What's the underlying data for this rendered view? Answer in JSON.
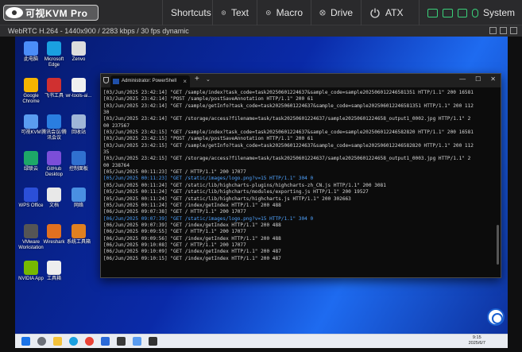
{
  "app": {
    "logo_text": "可视KVM Pro",
    "stream_info": "WebRTC H.264 - 1440x900 / 2283 kbps / 30 fps dynamic"
  },
  "menu": {
    "shortcuts": "Shortcuts",
    "text": "Text",
    "macro": "Macro",
    "drive": "Drive",
    "atx": "ATX",
    "system": "System"
  },
  "icons": {
    "text": "gear-icon",
    "macro": "gear-icon",
    "drive": "disc-icon",
    "atx": "power-icon"
  },
  "colors": {
    "accent_green": "#3ad17a",
    "link_blue": "#4fa3ff"
  },
  "desktop_icons": [
    {
      "label": "此电脑",
      "color": "#4b8df8"
    },
    {
      "label": "Microsoft Edge",
      "color": "#1aa0e0"
    },
    {
      "label": "Zenvo",
      "color": "#dddddd"
    },
    {
      "label": "Google Chrome",
      "color": "#f4b400"
    },
    {
      "label": "飞书工具",
      "color": "#d03030"
    },
    {
      "label": "wr-tools-ai...",
      "color": "#f0f0f0"
    },
    {
      "label": "可视KVM",
      "color": "#5a9cf0"
    },
    {
      "label": "腾讯会议/腾讯会议",
      "color": "#2a7ee0"
    },
    {
      "label": "回收站",
      "color": "#9fb6d8"
    },
    {
      "label": "绿联云",
      "color": "#1da868"
    },
    {
      "label": "GitHub Desktop",
      "color": "#7b4ed8"
    },
    {
      "label": "控制面板",
      "color": "#3070d0"
    },
    {
      "label": "WPS Office",
      "color": "#2b4fd8"
    },
    {
      "label": "文档",
      "color": "#e8e8e8"
    },
    {
      "label": "网络",
      "color": "#4a90e2"
    },
    {
      "label": "VMware Workstation",
      "color": "#555555"
    },
    {
      "label": "Wireshark",
      "color": "#e07020"
    },
    {
      "label": "系统工具箱",
      "color": "#e08020"
    },
    {
      "label": "NVIDIA App",
      "color": "#76b900"
    },
    {
      "label": "工具箱",
      "color": "#eeeeee"
    }
  ],
  "terminal": {
    "tab_title": "Administrator: PowerShell",
    "lines": [
      {
        "text": "[03/Jun/2025 23:42:14] \"GET /sample/index?task_code=task20250601224637&sample_code=sample202506012246581351 HTTP/1.1\" 200 16581",
        "blue": false
      },
      {
        "text": "[03/Jun/2025 23:42:14] \"POST /sample/postSaveAnnotation HTTP/1.1\" 200 61",
        "blue": false
      },
      {
        "text": "[03/Jun/2025 23:42:14] \"GET /sample/getInfo?task_code=task20250601224637&sample_code=sample202506012246581351 HTTP/1.1\" 200 112",
        "blue": false
      },
      {
        "text": "30",
        "blue": false
      },
      {
        "text": "[03/Jun/2025 23:42:14] \"GET /storage/access?filename=task/task20250601224637/sample20250601224658_output1_0002.jpg HTTP/1.1\" 2",
        "blue": false
      },
      {
        "text": "00 237567",
        "blue": false
      },
      {
        "text": "[03/Jun/2025 23:42:15] \"GET /sample/index?task_code=task20250601224637&sample_code=sample202506012246582820 HTTP/1.1\" 200 16581",
        "blue": false
      },
      {
        "text": "[03/Jun/2025 23:42:15] \"POST /sample/postSaveAnnotation HTTP/1.1\" 200 61",
        "blue": false
      },
      {
        "text": "[03/Jun/2025 23:42:15] \"GET /sample/getInfo?task_code=task20250601224637&sample_code=sample202506012246582820 HTTP/1.1\" 200 112",
        "blue": false
      },
      {
        "text": "35",
        "blue": false
      },
      {
        "text": "[03/Jun/2025 23:42:15] \"GET /storage/access?filename=task/task20250601224637/sample20250601224658_output1_0003.jpg HTTP/1.1\" 2",
        "blue": false
      },
      {
        "text": "00 238764",
        "blue": false
      },
      {
        "text": "[05/Jun/2025 00:11:23] \"GET / HTTP/1.1\" 200 17077",
        "blue": false
      },
      {
        "text": "[05/Jun/2025 00:11:23] \"GET /static/images/logo.png?v=15 HTTP/1.1\" 304 0",
        "blue": true
      },
      {
        "text": "[05/Jun/2025 00:11:24] \"GET /static/lib/highcharts-plugins/highcharts-zh_CN.js HTTP/1.1\" 200 3081",
        "blue": false
      },
      {
        "text": "[05/Jun/2025 00:11:24] \"GET /static/lib/highcharts/modules/exporting.js HTTP/1.1\" 200 19527",
        "blue": false
      },
      {
        "text": "[05/Jun/2025 00:11:24] \"GET /static/lib/highcharts/highcharts.js HTTP/1.1\" 200 302663",
        "blue": false
      },
      {
        "text": "[05/Jun/2025 00:11:24] \"GET /index/getIndex HTTP/1.1\" 200 488",
        "blue": false
      },
      {
        "text": "[06/Jun/2025 09:07:38] \"GET / HTTP/1.1\" 200 17077",
        "blue": false
      },
      {
        "text": "[06/Jun/2025 09:07:39] \"GET /static/images/logo.png?v=15 HTTP/1.1\" 304 0",
        "blue": true
      },
      {
        "text": "[06/Jun/2025 09:07:39] \"GET /index/getIndex HTTP/1.1\" 200 488",
        "blue": false
      },
      {
        "text": "[06/Jun/2025 09:09:55] \"GET / HTTP/1.1\" 200 17077",
        "blue": false
      },
      {
        "text": "[06/Jun/2025 09:09:56] \"GET /index/getIndex HTTP/1.1\" 200 488",
        "blue": false
      },
      {
        "text": "[06/Jun/2025 09:10:08] \"GET / HTTP/1.1\" 200 17077",
        "blue": false
      },
      {
        "text": "[06/Jun/2025 09:10:09] \"GET /index/getIndex HTTP/1.1\" 200 487",
        "blue": false
      },
      {
        "text": "[06/Jun/2025 09:10:15] \"GET /index/getIndex HTTP/1.1\" 200 487",
        "blue": false
      }
    ]
  },
  "taskbar": {
    "time": "9:15",
    "date": "2025/6/7"
  }
}
